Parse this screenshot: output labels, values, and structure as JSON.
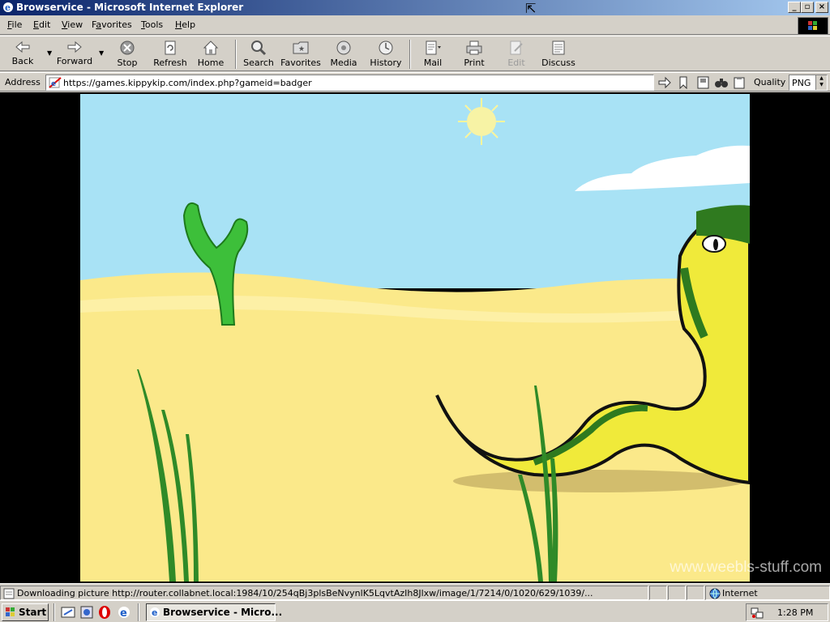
{
  "window": {
    "title": "Browservice - Microsoft Internet Explorer",
    "controls": [
      "minimize",
      "maximize",
      "close"
    ]
  },
  "menu": {
    "items": [
      {
        "accel": "F",
        "rest": "ile"
      },
      {
        "accel": "E",
        "rest": "dit"
      },
      {
        "accel": "V",
        "rest": "iew"
      },
      {
        "pre": "F",
        "accel": "a",
        "rest": "vorites"
      },
      {
        "accel": "T",
        "rest": "ools"
      },
      {
        "accel": "H",
        "rest": "elp"
      }
    ]
  },
  "toolbar": {
    "back": "Back",
    "forward": "Forward",
    "stop": "Stop",
    "refresh": "Refresh",
    "home": "Home",
    "search": "Search",
    "favorites": "Favorites",
    "media": "Media",
    "history": "History",
    "mail": "Mail",
    "print": "Print",
    "edit": "Edit",
    "discuss": "Discuss"
  },
  "address": {
    "label": "Address",
    "url": "https://games.kippykip.com/index.php?gameid=badger",
    "quality_label": "Quality",
    "quality_value": "PNG"
  },
  "content": {
    "watermark": "www.weebls-stuff.com",
    "icons": [
      "sun",
      "cactus",
      "snake",
      "grass",
      "cloud"
    ]
  },
  "status": {
    "text": "Downloading picture http://router.collabnet.local:1984/10/254qBj3plsBeNvynlK5LqvtAzIh8Jlxw/image/1/7214/0/1020/629/1039/...",
    "zone": "Internet"
  },
  "taskbar": {
    "start": "Start",
    "task": "Browservice - Micro...",
    "clock": "1:28 PM"
  },
  "colors": {
    "title_start": "#0a246a",
    "title_end": "#a6caf0",
    "chrome": "#d4d0c8",
    "sky": "#a8e2f5",
    "sand": "#fbe98a",
    "snake": "#f0ea3a",
    "snake_dark": "#2f7a1f"
  }
}
